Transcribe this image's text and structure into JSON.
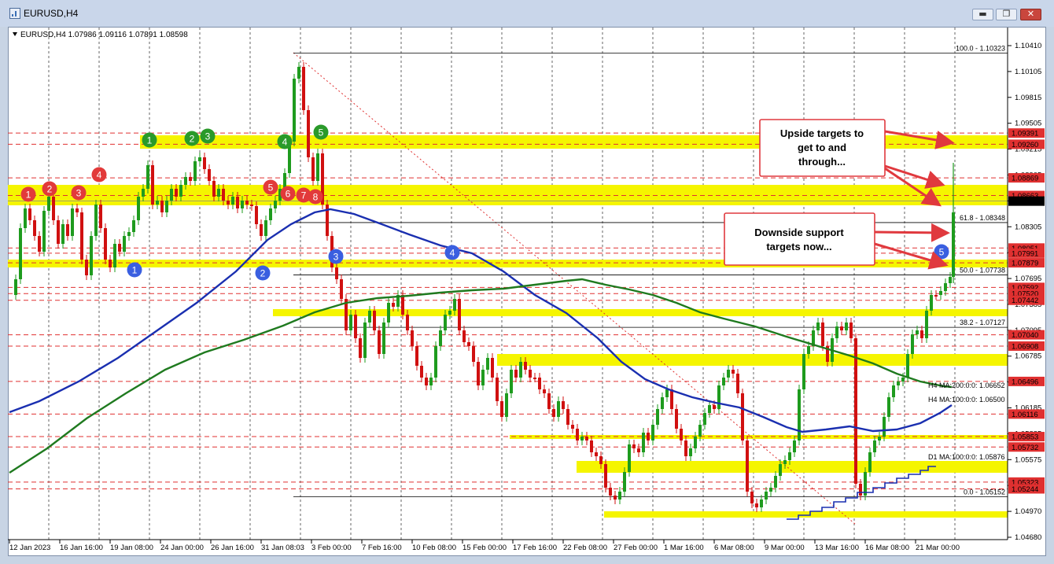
{
  "window": {
    "title": "EURUSD,H4",
    "buttons": {
      "minimize": "▬",
      "restore": "❐",
      "close": "✕"
    }
  },
  "chart_header": {
    "symbol_line": "EURUSD,H4  1.07986 1.09116 1.07891 1.08598"
  },
  "price_axis": {
    "ticks": [
      "1.10410",
      "1.10105",
      "1.09815",
      "1.09505",
      "1.09215",
      "1.08905",
      "1.08615",
      "1.08305",
      "1.07995",
      "1.07695",
      "1.07385",
      "1.07095",
      "1.06785",
      "1.06495",
      "1.06185",
      "1.05885",
      "1.05575",
      "1.05275",
      "1.04970",
      "1.04680"
    ],
    "level_labels": [
      {
        "text": "1.09391",
        "price": 1.09391,
        "color": "#e03030"
      },
      {
        "text": "1.09260",
        "price": 1.0926,
        "color": "#e03030"
      },
      {
        "text": "1.08869",
        "price": 1.08869,
        "color": "#e03030"
      },
      {
        "text": "1.08663",
        "price": 1.08663,
        "color": "#e03030"
      },
      {
        "text": "1.08598",
        "price": 1.08598,
        "color": "#000000"
      },
      {
        "text": "1.08051",
        "price": 1.08051,
        "color": "#e03030"
      },
      {
        "text": "1.07991",
        "price": 1.07991,
        "color": "#e03030"
      },
      {
        "text": "1.07879",
        "price": 1.07879,
        "color": "#e03030"
      },
      {
        "text": "1.07592",
        "price": 1.07592,
        "color": "#e03030"
      },
      {
        "text": "1.07520",
        "price": 1.0752,
        "color": "#e03030"
      },
      {
        "text": "1.07442",
        "price": 1.07442,
        "color": "#e03030"
      },
      {
        "text": "1.07040",
        "price": 1.0704,
        "color": "#e03030"
      },
      {
        "text": "1.06908",
        "price": 1.06908,
        "color": "#e03030"
      },
      {
        "text": "1.06496",
        "price": 1.06496,
        "color": "#e03030"
      },
      {
        "text": "1.06116",
        "price": 1.06116,
        "color": "#e03030"
      },
      {
        "text": "1.05853",
        "price": 1.05853,
        "color": "#e03030"
      },
      {
        "text": "1.05732",
        "price": 1.05732,
        "color": "#e03030"
      },
      {
        "text": "1.05323",
        "price": 1.05323,
        "color": "#e03030"
      },
      {
        "text": "1.05244",
        "price": 1.05244,
        "color": "#e03030"
      }
    ]
  },
  "time_axis": {
    "ticks": [
      "12 Jan 2023",
      "16 Jan 16:00",
      "19 Jan 08:00",
      "24 Jan 00:00",
      "26 Jan 16:00",
      "31 Jan 08:03",
      "3 Feb 00:00",
      "7 Feb 16:00",
      "10 Feb 08:00",
      "15 Feb 00:00",
      "17 Feb 16:00",
      "22 Feb 08:00",
      "27 Feb 00:00",
      "1 Mar 16:00",
      "6 Mar 08:00",
      "9 Mar 00:00",
      "13 Mar 16:00",
      "16 Mar 08:00",
      "21 Mar 00:00"
    ]
  },
  "fibonacci": [
    {
      "text": "100.0 - 1.10323",
      "price": 1.10323
    },
    {
      "text": "61.8 - 1.08348",
      "price": 1.08348
    },
    {
      "text": "50.0 - 1.07738",
      "price": 1.07738
    },
    {
      "text": "38.2 - 1.07127",
      "price": 1.07127
    },
    {
      "text": "0.0 - 1.05152",
      "price": 1.05152
    }
  ],
  "moving_averages": [
    {
      "text": "H4 MA:200:0:0: 1.06652",
      "color": "#1f7a1f"
    },
    {
      "text": "H4 MA:100:0:0: 1.06500",
      "color": "#1a2fb0"
    },
    {
      "text": "D1 MA:100:0:0: 1.05876",
      "color": "#1a2fb0"
    }
  ],
  "callouts": {
    "upside": [
      "Upside targets to",
      "get to and",
      "through..."
    ],
    "downside": [
      "Downside support",
      "targets now..."
    ]
  },
  "badges": {
    "red": [
      "1",
      "2",
      "3",
      "4",
      "5",
      "6",
      "7",
      "8"
    ],
    "green": [
      "1",
      "2",
      "3",
      "4",
      "5"
    ],
    "blue": [
      "1",
      "2",
      "3",
      "4",
      "5"
    ]
  },
  "colors": {
    "zone_yellow": "#f5f500",
    "level_red": "#e03030",
    "ma200_green": "#1f7a1f",
    "ma100_blue": "#1a2fb0",
    "candle_green": "#1e9b1e",
    "candle_red": "#d01010",
    "badge_red": "#e23a3a",
    "badge_green": "#2a9a2a",
    "badge_blue": "#3a5fe0"
  }
}
